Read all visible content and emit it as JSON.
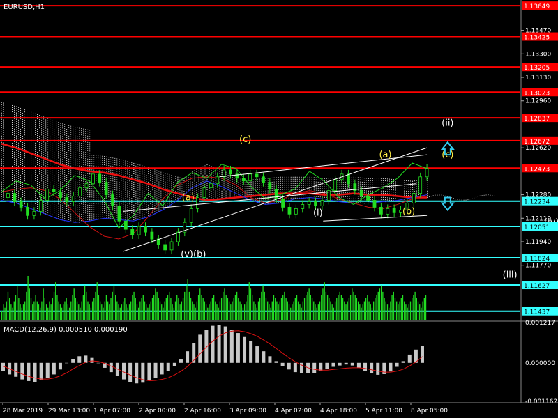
{
  "header": {
    "symbol_label": "EURUSD,H1"
  },
  "macd": {
    "label": "MACD(12,26,9) 0.000510 0.000190",
    "axis_labels": [
      "0.001217",
      "0.000000",
      "-0.001162"
    ]
  },
  "colors": {
    "background": "#000000",
    "resistance": "#ff0000",
    "support": "#33ffff",
    "price_line": "#ffffff",
    "green": "#22dd22",
    "wave_yellow": "#ffee44",
    "arrow": "#33ccee",
    "macd_signal": "#dd1111",
    "macd_hist": "#c8c8c8"
  },
  "chart_data": [
    {
      "type": "line",
      "title": "EURUSD,H1",
      "y_ticks": [
        "1.13470",
        "1.13300",
        "1.13130",
        "1.12960",
        "1.12620",
        "1.12280",
        "1.12110",
        "1.11940",
        "1.11770"
      ],
      "ylim": [
        1.1137,
        1.1369
      ],
      "grid": false,
      "horizontal_levels": [
        {
          "value": 1.13649,
          "label": "1.13649",
          "kind": "resistance"
        },
        {
          "value": 1.13425,
          "label": "1.13425",
          "kind": "resistance"
        },
        {
          "value": 1.13205,
          "label": "1.13205",
          "kind": "resistance"
        },
        {
          "value": 1.13023,
          "label": "1.13023",
          "kind": "resistance"
        },
        {
          "value": 1.12837,
          "label": "1.12837",
          "kind": "resistance"
        },
        {
          "value": 1.12672,
          "label": "1.12672",
          "kind": "resistance"
        },
        {
          "value": 1.12473,
          "label": "1.12473",
          "kind": "resistance"
        },
        {
          "value": 1.12234,
          "label": "1.12234",
          "kind": "support"
        },
        {
          "value": 1.12051,
          "label": "1.12051",
          "kind": "support"
        },
        {
          "value": 1.11824,
          "label": "1.11824",
          "kind": "support"
        },
        {
          "value": 1.11627,
          "label": "1.11627",
          "kind": "support"
        },
        {
          "value": 1.11437,
          "label": "1.11437",
          "kind": "support"
        }
      ],
      "wave_labels": [
        {
          "text": "(c)",
          "t": 0.47,
          "price": 1.1266,
          "color": "yellow"
        },
        {
          "text": "(a)",
          "t": 0.36,
          "price": 1.1224,
          "color": "yellow"
        },
        {
          "text": "(v)(b)",
          "t": 0.37,
          "price": 1.1183,
          "color": "white"
        },
        {
          "text": "(a)",
          "t": 0.74,
          "price": 1.1255,
          "color": "yellow"
        },
        {
          "text": "(i)",
          "t": 0.61,
          "price": 1.1213,
          "color": "white"
        },
        {
          "text": "(b)",
          "t": 0.785,
          "price": 1.1214,
          "color": "yellow"
        },
        {
          "text": "(c)",
          "t": 0.86,
          "price": 1.1255,
          "color": "yellow"
        },
        {
          "text": "(ii)",
          "t": 0.86,
          "price": 1.1278,
          "color": "white"
        },
        {
          "text": "(iv)",
          "t": 1.06,
          "price": 1.1206,
          "color": "white"
        },
        {
          "text": "(iii)",
          "t": 0.98,
          "price": 1.1168,
          "color": "white"
        }
      ],
      "price_series": [
        1.1226,
        1.1229,
        1.1223,
        1.1219,
        1.1213,
        1.1216,
        1.1224,
        1.1232,
        1.123,
        1.1226,
        1.1223,
        1.1227,
        1.1233,
        1.1236,
        1.1243,
        1.1237,
        1.1228,
        1.122,
        1.1209,
        1.1203,
        1.1199,
        1.1205,
        1.1201,
        1.1196,
        1.1192,
        1.1188,
        1.1194,
        1.1201,
        1.1208,
        1.1218,
        1.1226,
        1.1233,
        1.1236,
        1.1241,
        1.1246,
        1.1243,
        1.124,
        1.1238,
        1.1243,
        1.1241,
        1.1237,
        1.1232,
        1.1225,
        1.1219,
        1.1214,
        1.1218,
        1.1221,
        1.1223,
        1.122,
        1.1224,
        1.1231,
        1.1239,
        1.1243,
        1.1236,
        1.1231,
        1.1227,
        1.1224,
        1.1219,
        1.1214,
        1.1218,
        1.1215,
        1.1217,
        1.1222,
        1.1229,
        1.1241,
        1.1247
      ],
      "series": [
        {
          "name": "",
          "role": "ma-red",
          "values": [
            1.1265,
            1.1262,
            1.1258,
            1.1254,
            1.125,
            1.1247,
            1.1245,
            1.1244,
            1.1242,
            1.1239,
            1.1236,
            1.1232,
            1.1229,
            1.1226,
            1.1224,
            1.1225,
            1.1226,
            1.1227,
            1.1228,
            1.1229,
            1.1229,
            1.1229,
            1.1228,
            1.1228,
            1.1229,
            1.1228,
            1.1228,
            1.1227,
            1.1226,
            1.1226
          ]
        },
        {
          "name": "",
          "role": "ma-red-fast",
          "values": [
            1.123,
            1.1232,
            1.1233,
            1.1231,
            1.1225,
            1.1215,
            1.1205,
            1.1198,
            1.1196,
            1.12,
            1.1212,
            1.1225,
            1.1235,
            1.124,
            1.1241,
            1.124,
            1.1235,
            1.1226,
            1.1222,
            1.1224,
            1.1229,
            1.1231,
            1.1229,
            1.1225,
            1.1222,
            1.1219,
            1.1218,
            1.1221,
            1.1225,
            1.1228
          ]
        },
        {
          "name": "",
          "role": "ma-blue",
          "values": [
            1.1224,
            1.1222,
            1.1218,
            1.1214,
            1.121,
            1.1208,
            1.1209,
            1.1211,
            1.121,
            1.1209,
            1.1212,
            1.1217,
            1.1224,
            1.1233,
            1.1238,
            1.1234,
            1.1229,
            1.1224,
            1.1221,
            1.1222,
            1.1225,
            1.1226,
            1.1225,
            1.1223,
            1.1222,
            1.1222,
            1.1223,
            1.1224,
            1.1226,
            1.1228
          ]
        },
        {
          "name": "",
          "role": "chikou-green",
          "values": [
            1.123,
            1.1238,
            1.1235,
            1.1225,
            1.1231,
            1.1242,
            1.1238,
            1.1224,
            1.1204,
            1.1213,
            1.1229,
            1.122,
            1.1237,
            1.1244,
            1.124,
            1.125,
            1.1247,
            1.1234,
            1.1225,
            1.1228,
            1.1232,
            1.1245,
            1.1238,
            1.1226,
            1.1221,
            1.1228,
            1.1233,
            1.124,
            1.1251,
            1.1247
          ]
        }
      ],
      "trend_lines": [
        {
          "from": [
            0.235,
            1.1187
          ],
          "to": [
            0.82,
            1.1262
          ]
        },
        {
          "from": [
            0.235,
            1.1216
          ],
          "to": [
            0.8,
            1.1236
          ]
        },
        {
          "from": [
            0.42,
            1.1241
          ],
          "to": [
            0.82,
            1.1257
          ]
        },
        {
          "from": [
            0.62,
            1.1209
          ],
          "to": [
            0.82,
            1.1213
          ]
        }
      ],
      "arrows": [
        {
          "direction": "up",
          "t": 0.86,
          "price": 1.1261
        },
        {
          "direction": "down",
          "t": 0.86,
          "price": 1.1222
        }
      ]
    },
    {
      "type": "bar",
      "title": "volume",
      "values": [
        3,
        5,
        4,
        6,
        9,
        7,
        5,
        4,
        6,
        8,
        11,
        7,
        5,
        4,
        5,
        6,
        9,
        14,
        10,
        7,
        5,
        6,
        8,
        6,
        5,
        4,
        6,
        10,
        7,
        5,
        4,
        6,
        5,
        7,
        9,
        12,
        8,
        6,
        5,
        4,
        5,
        6,
        7,
        5,
        4,
        6,
        8,
        10,
        7,
        6,
        5,
        4,
        6,
        8,
        11,
        9,
        6,
        5,
        4,
        6,
        7,
        9,
        12,
        8,
        6,
        5,
        4,
        6,
        8,
        6,
        5,
        7,
        9,
        11,
        8,
        6,
        5,
        4,
        5,
        6,
        7,
        5,
        4,
        5,
        6,
        8,
        9,
        7,
        5,
        4,
        6,
        7,
        8,
        6,
        5,
        4,
        5,
        6,
        7,
        8,
        10,
        9,
        7,
        6,
        5,
        4,
        6,
        7,
        8,
        9,
        7,
        5,
        4,
        6,
        8,
        7,
        5,
        6,
        7,
        9,
        11,
        13,
        9,
        7,
        6,
        5,
        4,
        6,
        8,
        10,
        8,
        7,
        6,
        5,
        4,
        5,
        6,
        7,
        8,
        6,
        5,
        4,
        6,
        7,
        9,
        10,
        8,
        7,
        6,
        5,
        6,
        7,
        8,
        9,
        7,
        6,
        5,
        4,
        5,
        6,
        8,
        12,
        10,
        8,
        6,
        5,
        4,
        6,
        7,
        9,
        11,
        9,
        7,
        6,
        5,
        4,
        6,
        8,
        7,
        6,
        5,
        6,
        7,
        8,
        9,
        7,
        6,
        5,
        4,
        5,
        6,
        7,
        8,
        6,
        5,
        4,
        6,
        7,
        8,
        9,
        10,
        8,
        7,
        6,
        5,
        4,
        5,
        6,
        8,
        10,
        12,
        9,
        8,
        7,
        6,
        5,
        4,
        6,
        7,
        8,
        9,
        8,
        7,
        6,
        5,
        6,
        7,
        8,
        10,
        9,
        8,
        7,
        6,
        5,
        4,
        5,
        6,
        7,
        8,
        6,
        5,
        4,
        6,
        7,
        8,
        9,
        10,
        11,
        9,
        7,
        6,
        5,
        4,
        6,
        8,
        9,
        7,
        6,
        5,
        6,
        7,
        8,
        6,
        5,
        4,
        5,
        6,
        7,
        8,
        9,
        7,
        6,
        5,
        4,
        6,
        7,
        8
      ]
    },
    {
      "type": "bar",
      "title": "MACD(12,26,9) 0.000510 0.000190",
      "ylim": [
        -0.001162,
        0.001217
      ],
      "histogram": [
        -0.00025,
        -0.00035,
        -0.00042,
        -0.0005,
        -0.00055,
        -0.00058,
        -0.00052,
        -0.00045,
        -0.00035,
        -0.0002,
        0.0,
        0.00012,
        0.0002,
        0.00022,
        0.00015,
        0.0,
        -0.00015,
        -0.00028,
        -0.0004,
        -0.0005,
        -0.00058,
        -0.00062,
        -0.0006,
        -0.00054,
        -0.00045,
        -0.00035,
        -0.00025,
        -0.0001,
        0.0001,
        0.00035,
        0.0006,
        0.00085,
        0.001,
        0.00112,
        0.00115,
        0.0011,
        0.001,
        0.0009,
        0.00078,
        0.00065,
        0.0005,
        0.00035,
        0.0002,
        5e-05,
        -0.0001,
        -0.0002,
        -0.00028,
        -0.0003,
        -0.00032,
        -0.0003,
        -0.00024,
        -0.00018,
        -0.00012,
        -8e-05,
        -5e-05,
        -8e-05,
        -0.00015,
        -0.00025,
        -0.00032,
        -0.00036,
        -0.00034,
        -0.00026,
        -0.00012,
        5e-05,
        0.00025,
        0.0004,
        0.00051
      ],
      "signal": [
        -0.0001,
        -0.00018,
        -0.00026,
        -0.00034,
        -0.00041,
        -0.00046,
        -0.00049,
        -0.00049,
        -0.00046,
        -0.00039,
        -0.0003,
        -0.00018,
        -8e-05,
        2e-05,
        6e-05,
        4e-05,
        -2e-05,
        -0.0001,
        -0.00019,
        -0.00028,
        -0.00037,
        -0.00045,
        -0.00051,
        -0.00054,
        -0.00053,
        -0.0005,
        -0.00045,
        -0.00036,
        -0.00025,
        -0.00011,
        8e-05,
        0.00028,
        0.00048,
        0.00066,
        0.00081,
        0.00091,
        0.00096,
        0.00097,
        0.00094,
        0.00088,
        0.0008,
        0.00069,
        0.00057,
        0.00043,
        0.00029,
        0.00015,
        3e-05,
        -7e-05,
        -0.00015,
        -0.0002,
        -0.00022,
        -0.00022,
        -0.0002,
        -0.00018,
        -0.00016,
        -0.00015,
        -0.00015,
        -0.00017,
        -0.00021,
        -0.00025,
        -0.00028,
        -0.00028,
        -0.00025,
        -0.00019,
        -9e-05,
        3e-05,
        0.00019
      ]
    }
  ],
  "x_axis_labels": [
    "28 Mar 2019",
    "29 Mar 13:00",
    "1 Apr 07:00",
    "2 Apr 00:00",
    "2 Apr 16:00",
    "3 Apr 09:00",
    "4 Apr 02:00",
    "4 Apr 18:00",
    "5 Apr 11:00",
    "8 Apr 05:00"
  ]
}
